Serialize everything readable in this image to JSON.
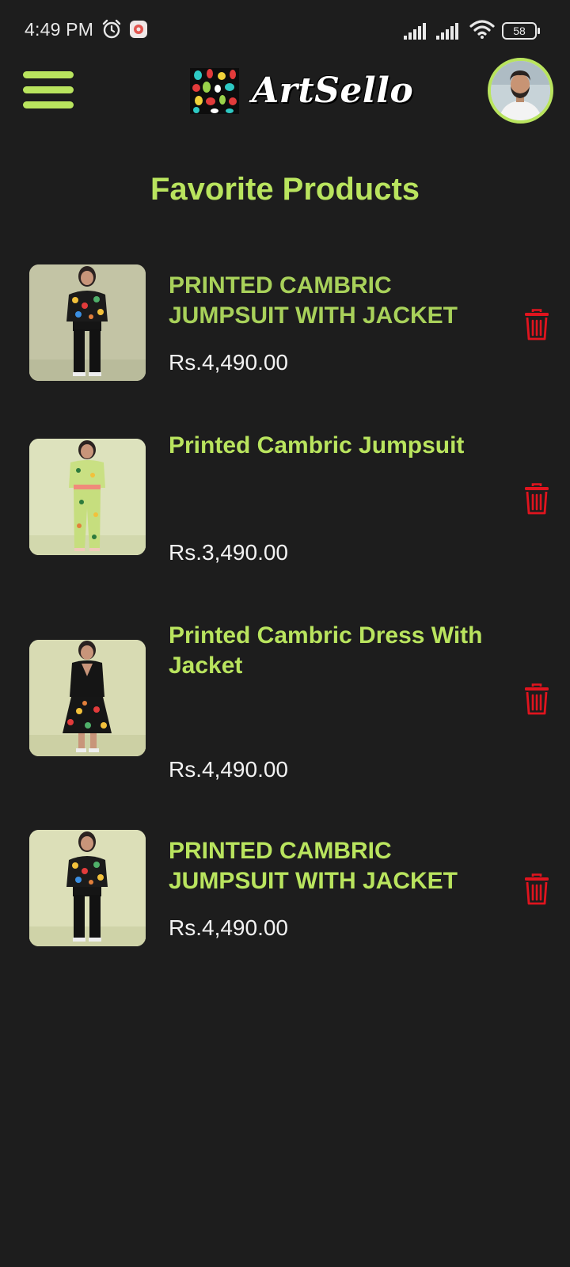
{
  "status_bar": {
    "time": "4:49 PM",
    "battery": "58",
    "icons": [
      "alarm-icon",
      "app-notification-icon",
      "signal-icon",
      "signal-icon",
      "wifi-icon",
      "battery-icon"
    ]
  },
  "header": {
    "menu_icon": "hamburger-menu-icon",
    "brand_name": "ArtSello",
    "accent_color": "#b9e45e"
  },
  "page": {
    "title": "Favorite Products",
    "background_color": "#1d1d1d"
  },
  "favorites": [
    {
      "name": "PRINTED CAMBRIC JUMPSUIT WITH JACKET",
      "price": "Rs.4,490.00"
    },
    {
      "name": "Printed Cambric Jumpsuit",
      "price": "Rs.3,490.00"
    },
    {
      "name": "Printed Cambric Dress With Jacket",
      "price": "Rs.4,490.00"
    },
    {
      "name": "PRINTED CAMBRIC JUMPSUIT WITH JACKET",
      "price": "Rs.4,490.00"
    }
  ],
  "delete_icon_color": "#e0141e"
}
